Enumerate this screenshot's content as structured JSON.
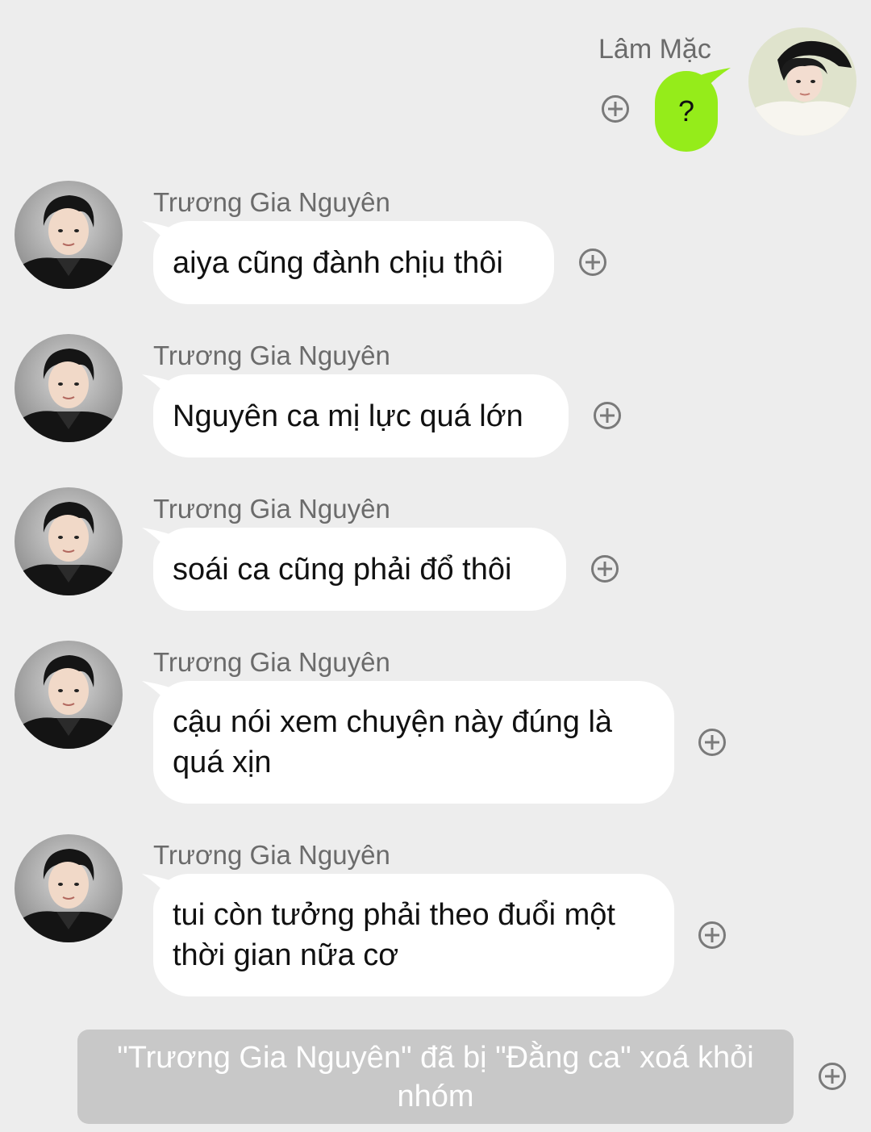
{
  "me": {
    "name": "Lâm Mặc",
    "message": "?",
    "bubble_color": "#95ec1a",
    "avatar_icon": "user-avatar-black-hat"
  },
  "messages": [
    {
      "sender": "Trương Gia Nguyên",
      "text": "aiya cũng đành chịu thôi"
    },
    {
      "sender": "Trương Gia Nguyên",
      "text": "Nguyên ca mị lực quá lớn"
    },
    {
      "sender": "Trương Gia Nguyên",
      "text": "soái ca cũng phải đổ thôi"
    },
    {
      "sender": "Trương Gia Nguyên",
      "text": "cậu nói xem chuyện này đúng là quá xịn"
    },
    {
      "sender": "Trương Gia Nguyên",
      "text": "tui còn tưởng phải theo đuổi một thời gian nữa cơ"
    }
  ],
  "system_note": "\"Trương Gia Nguyên\" đã bị \"Đằng ca\" xoá khỏi nhóm",
  "colors": {
    "background": "#ededed",
    "system_note_bg": "#c8c8c8"
  }
}
